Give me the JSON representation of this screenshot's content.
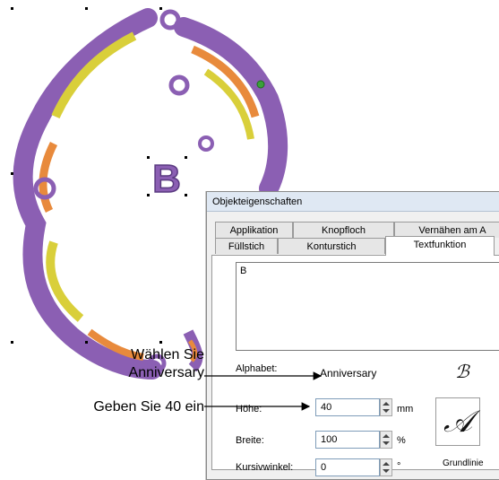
{
  "canvas": {
    "selected_letter": "B",
    "accent_purple": "#8b5fb3",
    "accent_yellow": "#d9cf3a",
    "accent_orange": "#e88a3c"
  },
  "callouts": {
    "choose_line1": "Wählen Sie",
    "choose_line2": "Anniversary",
    "enter_value": "Geben Sie 40 ein"
  },
  "dialog": {
    "title": "Objekteigenschaften",
    "tabs_row1": [
      "Applikation",
      "Knopfloch",
      "Vernähen am A"
    ],
    "tabs_row2": [
      "Füllstich",
      "Konturstich",
      "Textfunktion"
    ],
    "active_tab": "Textfunktion",
    "text_value": "B",
    "alphabet_label": "Alphabet:",
    "alphabet_value": "Anniversary",
    "hoehe_label": "Höhe:",
    "hoehe_value": "40",
    "hoehe_unit": "mm",
    "breite_label": "Breite:",
    "breite_value": "100",
    "breite_unit": "%",
    "kursiv_label": "Kursivwinkel:",
    "kursiv_value": "0",
    "kursiv_unit": "°",
    "grundlinie_label": "Grundlinie",
    "alphabet_preview_glyph": "ℬ",
    "style_preview_glyph": "𝒜"
  }
}
